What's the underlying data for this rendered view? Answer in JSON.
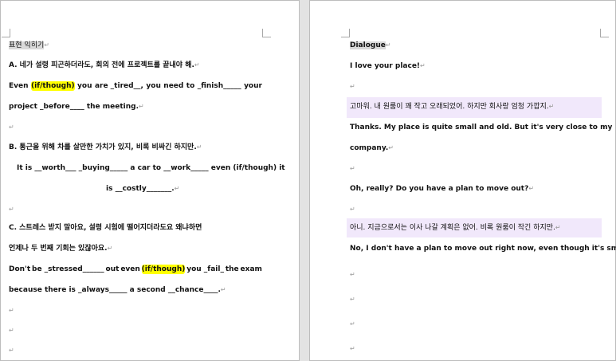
{
  "left": {
    "heading": "표현 익히기",
    "a_korean": "A. 네가 설령 피곤하더라도, 회의 전에 프로젝트를 끝내야 해.",
    "a_en1": [
      "Even",
      "(if/though)",
      "you",
      "are _tired__,",
      "you",
      "need",
      "to",
      "_finish_____",
      "your"
    ],
    "a_en2": "project _before____ the meeting.",
    "b_korean": "B. 통근을 위해 차를 살만한 가치가 있지, 비록 비싸긴 하지만.",
    "b_en1": "It is __worth___ _buying_____ a car to __work_____ even (if/though) it",
    "b_en2": "is __costly_______.",
    "c_korean1": "C. 스트레스 받지 말아요, 설령 시험에 떨어지더라도요 왜냐하면",
    "c_korean2": "언제나 두 번째 기회는 있잖아요.",
    "c_en1": [
      "Don't",
      "be _stressed______",
      "out",
      "even",
      "(if/though)",
      "you _fail_",
      "the",
      "exam"
    ],
    "c_en2": "because there is _always_____ a second __chance____."
  },
  "right": {
    "heading": "Dialogue",
    "line1": "I love your place!",
    "kor1": "고마워. 내 원룸이 꽤 작고 오래되었어. 하지만 회사랑 엄청 가깝지.",
    "en1a": "Thanks. My place is quite small and old. But it's very close to my",
    "en1b": "company.",
    "line2": "Oh, really? Do you have a plan to move out?",
    "kor2": "아니. 지금으로서는 이사 나갈 계획은 없어. 비록 원룸이 작긴 하지만.",
    "en2": "No, I don't have a plan to move out right now, even though it's small."
  },
  "marks": {
    "paragraph": "↵"
  }
}
